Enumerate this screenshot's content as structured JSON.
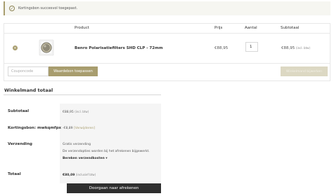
{
  "notice": {
    "icon": "check-circle-icon",
    "text": "Kortingsbon succesvol toegepast."
  },
  "cart": {
    "headers": {
      "product": "Product",
      "price": "Prijs",
      "quantity": "Aantal",
      "subtotal": "Subtotaal"
    },
    "item": {
      "remove_icon": "remove-icon",
      "name": "Benro Polarisatiefilters SHD CLP - 72mm",
      "price": "€88,95",
      "quantity": "1",
      "subtotal": "€88,95",
      "subtotal_note": "(incl. btw)"
    },
    "coupon_placeholder": "Couponcode",
    "apply_label": "Waardebon toepassen",
    "update_label": "Winkelmand bijwerken"
  },
  "totals": {
    "title": "Winkelmand totaal",
    "subtotal_label": "Subtotaal",
    "subtotal_value": "€88,95",
    "subtotal_note": "(incl. btw)",
    "coupon_label": "Kortingsbon: mwkqmfpx",
    "coupon_value": "-€8,89",
    "coupon_remove": "[Verwijderen]",
    "shipping_label": "Verzending",
    "shipping_free": "Gratis verzending",
    "shipping_note": "De verzendopties worden bij het afrekenen bijgewerkt.",
    "shipping_calc": "Bereken verzendkosten",
    "total_label": "Totaal",
    "total_value": "€80,09",
    "total_note": "(inclusief btw)",
    "checkout_label": "Doorgaan naar afrekenen"
  },
  "colors": {
    "accent": "#a89d6e",
    "dark_button": "#2f2f2f"
  }
}
